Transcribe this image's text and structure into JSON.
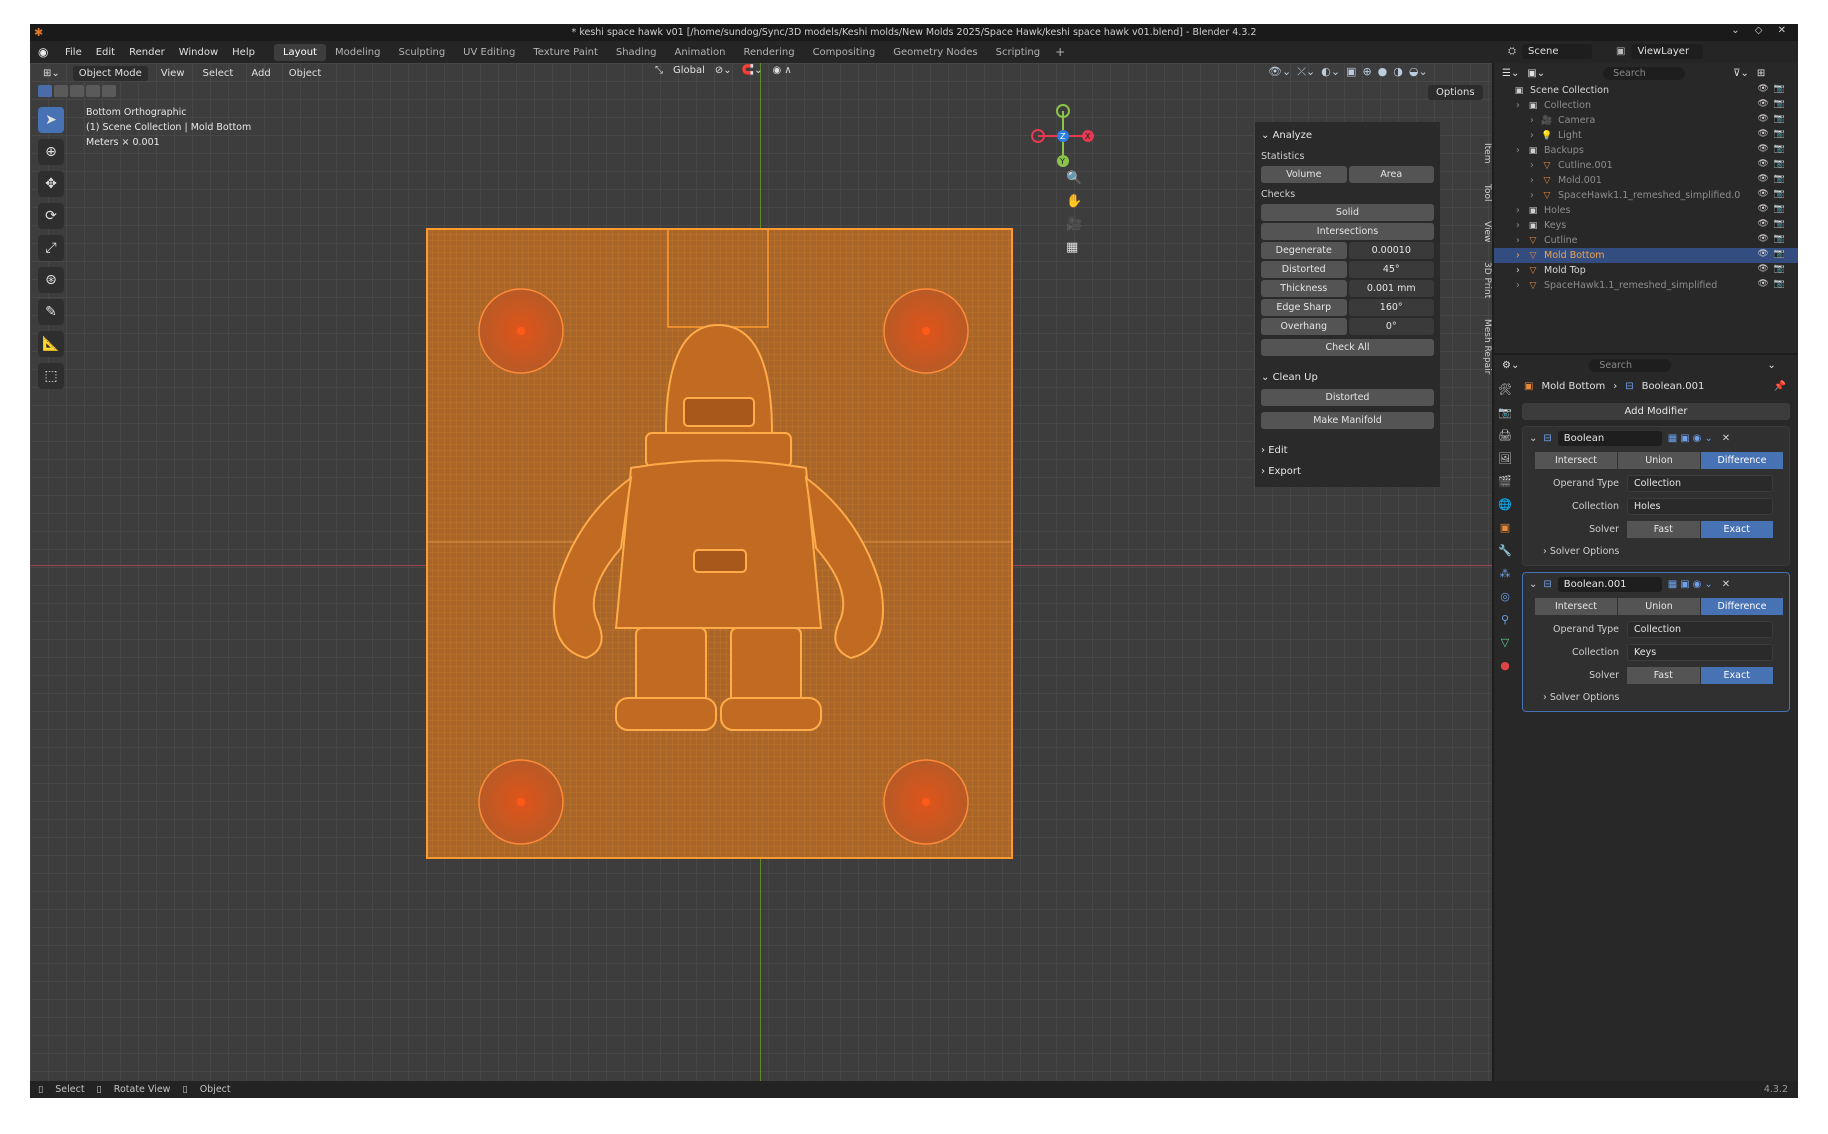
{
  "window": {
    "title": "* keshi space hawk v01 [/home/sundog/Sync/3D models/Keshi molds/New Molds 2025/Space Hawk/keshi space hawk v01.blend] - Blender 4.3.2",
    "controls": "⌄ ◇ ✕"
  },
  "menubar": {
    "menus": [
      "File",
      "Edit",
      "Render",
      "Window",
      "Help"
    ],
    "workspaces": [
      "Layout",
      "Modeling",
      "Sculpting",
      "UV Editing",
      "Texture Paint",
      "Shading",
      "Animation",
      "Rendering",
      "Compositing",
      "Geometry Nodes",
      "Scripting"
    ],
    "active_workspace": "Layout",
    "add": "+",
    "scene": "Scene",
    "view_layer": "ViewLayer"
  },
  "viewport": {
    "mode": "Object Mode",
    "menus": [
      "View",
      "Select",
      "Add",
      "Object"
    ],
    "transform_orientation": "Global",
    "options": "Options",
    "overlay_lines": [
      "Bottom Orthographic",
      "(1) Scene Collection | Mold Bottom",
      "Meters × 0.001"
    ],
    "gizmo_labels": {
      "x": "X",
      "y": "Y",
      "z": "Z"
    }
  },
  "npanel": {
    "analyze": "Analyze",
    "statistics": "Statistics",
    "volume": "Volume",
    "area": "Area",
    "checks": "Checks",
    "solid": "Solid",
    "intersections": "Intersections",
    "check_rows": [
      {
        "label": "Degenerate",
        "value": "0.00010"
      },
      {
        "label": "Distorted",
        "value": "45°"
      },
      {
        "label": "Thickness",
        "value": "0.001 mm"
      },
      {
        "label": "Edge Sharp",
        "value": "160°"
      },
      {
        "label": "Overhang",
        "value": "0°"
      }
    ],
    "check_all": "Check All",
    "clean_up": "Clean Up",
    "distorted": "Distorted",
    "make_manifold": "Make Manifold",
    "edit": "Edit",
    "export": "Export",
    "tabs": [
      "Item",
      "Tool",
      "View",
      "3D Print",
      "Mesh Repair"
    ]
  },
  "outliner": {
    "search_placeholder": "Search",
    "rows": [
      {
        "label": "Scene Collection",
        "indent": 0,
        "kind": "col",
        "state": "normal"
      },
      {
        "label": "Collection",
        "indent": 1,
        "kind": "col",
        "state": "dim"
      },
      {
        "label": "Camera",
        "indent": 2,
        "kind": "cam",
        "state": "dim"
      },
      {
        "label": "Light",
        "indent": 2,
        "kind": "light",
        "state": "dim"
      },
      {
        "label": "Backups",
        "indent": 1,
        "kind": "col",
        "state": "dim"
      },
      {
        "label": "Cutline.001",
        "indent": 2,
        "kind": "mesh",
        "state": "dim"
      },
      {
        "label": "Mold.001",
        "indent": 2,
        "kind": "mesh",
        "state": "dim"
      },
      {
        "label": "SpaceHawk1.1_remeshed_simplified.0",
        "indent": 2,
        "kind": "mesh",
        "state": "dim"
      },
      {
        "label": "Holes",
        "indent": 1,
        "kind": "col",
        "state": "dim"
      },
      {
        "label": "Keys",
        "indent": 1,
        "kind": "col",
        "state": "dim"
      },
      {
        "label": "Cutline",
        "indent": 1,
        "kind": "mesh",
        "state": "dim"
      },
      {
        "label": "Mold Bottom",
        "indent": 1,
        "kind": "mesh",
        "state": "sel"
      },
      {
        "label": "Mold Top",
        "indent": 1,
        "kind": "mesh",
        "state": "normal"
      },
      {
        "label": "SpaceHawk1.1_remeshed_simplified",
        "indent": 1,
        "kind": "mesh",
        "state": "dim"
      }
    ]
  },
  "properties": {
    "search_placeholder": "Search",
    "object": "Mold Bottom",
    "modifier": "Boolean.001",
    "add_modifier": "Add Modifier",
    "modifiers": [
      {
        "name": "Boolean",
        "ops": [
          "Intersect",
          "Union",
          "Difference"
        ],
        "active_op": "Difference",
        "operand_label": "Operand Type",
        "operand": "Collection",
        "collection_label": "Collection",
        "collection": "Holes",
        "solver_label": "Solver",
        "solvers": [
          "Fast",
          "Exact"
        ],
        "active_solver": "Exact",
        "solver_options": "Solver Options"
      },
      {
        "name": "Boolean.001",
        "ops": [
          "Intersect",
          "Union",
          "Difference"
        ],
        "active_op": "Difference",
        "operand_label": "Operand Type",
        "operand": "Collection",
        "collection_label": "Collection",
        "collection": "Keys",
        "solver_label": "Solver",
        "solvers": [
          "Fast",
          "Exact"
        ],
        "active_solver": "Exact",
        "solver_options": "Solver Options"
      }
    ]
  },
  "statusbar": {
    "hints": [
      "Select",
      "Rotate View",
      "Object"
    ],
    "version": "4.3.2"
  },
  "colors": {
    "accent": "#4772b3",
    "wire": "#ff9a2e",
    "selected_text": "#f0a34a"
  }
}
